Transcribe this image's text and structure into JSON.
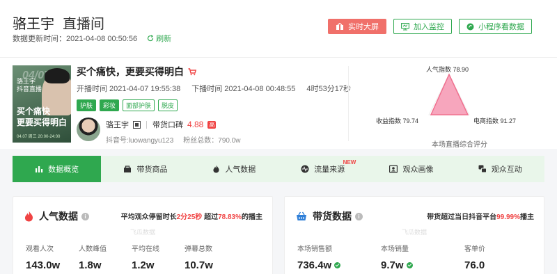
{
  "header": {
    "name": "骆王宇",
    "subtitle": "直播间",
    "update_label": "数据更新时间：2021-04-08 00:50:56",
    "refresh_label": "刷新",
    "buttons": {
      "realtime": "实时大屏",
      "monitor": "加入监控",
      "miniprogram": "小程序看数据"
    }
  },
  "live": {
    "cover": {
      "date_overlay": "04/07",
      "line1": "骆王宇",
      "line2": "抖音直播",
      "slogan1": "买个痛快",
      "slogan2": "更要买得明白",
      "footer": "04.07 周三 20:00-24:00"
    },
    "title": "买个痛快，更要买得明白",
    "start_time": "开播时间 2021-04-07 19:55:38",
    "end_time": "下播时间 2021-04-08 00:48:55",
    "duration": "4时53分17秒",
    "tags": [
      "护肤",
      "彩妆",
      "面部护肤",
      "脱皮"
    ],
    "host_name": "骆王宇",
    "reputation_label": "带货口碑",
    "reputation_score": "4.88",
    "reputation_badge": "高",
    "douyin_id": "抖音号:luowangyu123",
    "fans": "粉丝总数：790.0w"
  },
  "radar": {
    "popularity_label": "人气指数 78.90",
    "income_label": "收益指数 79.74",
    "ecommerce_label": "电商指数 91.27",
    "caption": "本场直播综合评分",
    "values": {
      "popularity": 78.9,
      "income": 79.74,
      "ecommerce": 91.27
    },
    "colors": {
      "popularity": "#f0708f",
      "income": "#e8a21c",
      "ecommerce": "#2fa84f"
    }
  },
  "tabs": [
    {
      "label": "数据概览",
      "active": true
    },
    {
      "label": "带货商品"
    },
    {
      "label": "人气数据"
    },
    {
      "label": "流量来源",
      "badge": "NEW"
    },
    {
      "label": "观众画像"
    },
    {
      "label": "观众互动"
    }
  ],
  "panels": {
    "popularity": {
      "title": "人气数据",
      "note_prefix": "平均观众停留时长",
      "note_hl1": "2分25秒",
      "note_mid": " 超过",
      "note_hl2": "78.83%",
      "note_suffix": "的播主",
      "watermark": "飞瓜数据",
      "stats": [
        {
          "label": "观看人次",
          "value": "143.0w"
        },
        {
          "label": "人数峰值",
          "value": "1.8w"
        },
        {
          "label": "平均在线",
          "value": "1.2w"
        },
        {
          "label": "弹幕总数",
          "value": "10.7w"
        }
      ]
    },
    "sales": {
      "title": "带货数据",
      "note_prefix": "带货超过当日抖音平台",
      "note_hl": "99.99%",
      "note_suffix": "播主",
      "watermark": "飞瓜数据",
      "stats": [
        {
          "label": "本场销售额",
          "value": "736.4w"
        },
        {
          "label": "本场销量",
          "value": "9.7w"
        },
        {
          "label": "客单价",
          "value": "76.0"
        }
      ]
    }
  },
  "accent": "#2fa84f",
  "alert": "#f04343"
}
